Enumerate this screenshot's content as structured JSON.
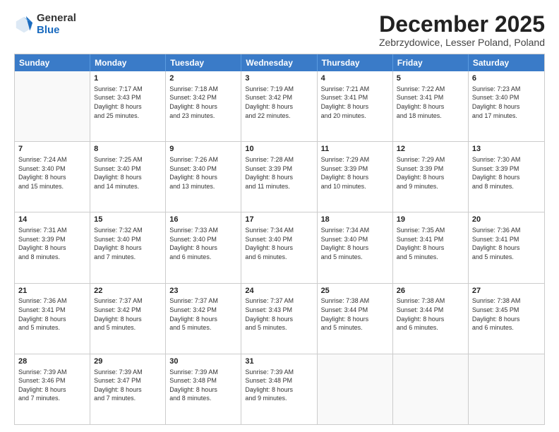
{
  "header": {
    "logo": {
      "general": "General",
      "blue": "Blue"
    },
    "title": "December 2025",
    "location": "Zebrzydowice, Lesser Poland, Poland"
  },
  "calendar": {
    "days": [
      "Sunday",
      "Monday",
      "Tuesday",
      "Wednesday",
      "Thursday",
      "Friday",
      "Saturday"
    ],
    "rows": [
      [
        {
          "day": "",
          "content": ""
        },
        {
          "day": "1",
          "content": "Sunrise: 7:17 AM\nSunset: 3:43 PM\nDaylight: 8 hours\nand 25 minutes."
        },
        {
          "day": "2",
          "content": "Sunrise: 7:18 AM\nSunset: 3:42 PM\nDaylight: 8 hours\nand 23 minutes."
        },
        {
          "day": "3",
          "content": "Sunrise: 7:19 AM\nSunset: 3:42 PM\nDaylight: 8 hours\nand 22 minutes."
        },
        {
          "day": "4",
          "content": "Sunrise: 7:21 AM\nSunset: 3:41 PM\nDaylight: 8 hours\nand 20 minutes."
        },
        {
          "day": "5",
          "content": "Sunrise: 7:22 AM\nSunset: 3:41 PM\nDaylight: 8 hours\nand 18 minutes."
        },
        {
          "day": "6",
          "content": "Sunrise: 7:23 AM\nSunset: 3:40 PM\nDaylight: 8 hours\nand 17 minutes."
        }
      ],
      [
        {
          "day": "7",
          "content": "Sunrise: 7:24 AM\nSunset: 3:40 PM\nDaylight: 8 hours\nand 15 minutes."
        },
        {
          "day": "8",
          "content": "Sunrise: 7:25 AM\nSunset: 3:40 PM\nDaylight: 8 hours\nand 14 minutes."
        },
        {
          "day": "9",
          "content": "Sunrise: 7:26 AM\nSunset: 3:40 PM\nDaylight: 8 hours\nand 13 minutes."
        },
        {
          "day": "10",
          "content": "Sunrise: 7:28 AM\nSunset: 3:39 PM\nDaylight: 8 hours\nand 11 minutes."
        },
        {
          "day": "11",
          "content": "Sunrise: 7:29 AM\nSunset: 3:39 PM\nDaylight: 8 hours\nand 10 minutes."
        },
        {
          "day": "12",
          "content": "Sunrise: 7:29 AM\nSunset: 3:39 PM\nDaylight: 8 hours\nand 9 minutes."
        },
        {
          "day": "13",
          "content": "Sunrise: 7:30 AM\nSunset: 3:39 PM\nDaylight: 8 hours\nand 8 minutes."
        }
      ],
      [
        {
          "day": "14",
          "content": "Sunrise: 7:31 AM\nSunset: 3:39 PM\nDaylight: 8 hours\nand 8 minutes."
        },
        {
          "day": "15",
          "content": "Sunrise: 7:32 AM\nSunset: 3:40 PM\nDaylight: 8 hours\nand 7 minutes."
        },
        {
          "day": "16",
          "content": "Sunrise: 7:33 AM\nSunset: 3:40 PM\nDaylight: 8 hours\nand 6 minutes."
        },
        {
          "day": "17",
          "content": "Sunrise: 7:34 AM\nSunset: 3:40 PM\nDaylight: 8 hours\nand 6 minutes."
        },
        {
          "day": "18",
          "content": "Sunrise: 7:34 AM\nSunset: 3:40 PM\nDaylight: 8 hours\nand 5 minutes."
        },
        {
          "day": "19",
          "content": "Sunrise: 7:35 AM\nSunset: 3:41 PM\nDaylight: 8 hours\nand 5 minutes."
        },
        {
          "day": "20",
          "content": "Sunrise: 7:36 AM\nSunset: 3:41 PM\nDaylight: 8 hours\nand 5 minutes."
        }
      ],
      [
        {
          "day": "21",
          "content": "Sunrise: 7:36 AM\nSunset: 3:41 PM\nDaylight: 8 hours\nand 5 minutes."
        },
        {
          "day": "22",
          "content": "Sunrise: 7:37 AM\nSunset: 3:42 PM\nDaylight: 8 hours\nand 5 minutes."
        },
        {
          "day": "23",
          "content": "Sunrise: 7:37 AM\nSunset: 3:42 PM\nDaylight: 8 hours\nand 5 minutes."
        },
        {
          "day": "24",
          "content": "Sunrise: 7:37 AM\nSunset: 3:43 PM\nDaylight: 8 hours\nand 5 minutes."
        },
        {
          "day": "25",
          "content": "Sunrise: 7:38 AM\nSunset: 3:44 PM\nDaylight: 8 hours\nand 5 minutes."
        },
        {
          "day": "26",
          "content": "Sunrise: 7:38 AM\nSunset: 3:44 PM\nDaylight: 8 hours\nand 6 minutes."
        },
        {
          "day": "27",
          "content": "Sunrise: 7:38 AM\nSunset: 3:45 PM\nDaylight: 8 hours\nand 6 minutes."
        }
      ],
      [
        {
          "day": "28",
          "content": "Sunrise: 7:39 AM\nSunset: 3:46 PM\nDaylight: 8 hours\nand 7 minutes."
        },
        {
          "day": "29",
          "content": "Sunrise: 7:39 AM\nSunset: 3:47 PM\nDaylight: 8 hours\nand 7 minutes."
        },
        {
          "day": "30",
          "content": "Sunrise: 7:39 AM\nSunset: 3:48 PM\nDaylight: 8 hours\nand 8 minutes."
        },
        {
          "day": "31",
          "content": "Sunrise: 7:39 AM\nSunset: 3:48 PM\nDaylight: 8 hours\nand 9 minutes."
        },
        {
          "day": "",
          "content": ""
        },
        {
          "day": "",
          "content": ""
        },
        {
          "day": "",
          "content": ""
        }
      ]
    ]
  }
}
